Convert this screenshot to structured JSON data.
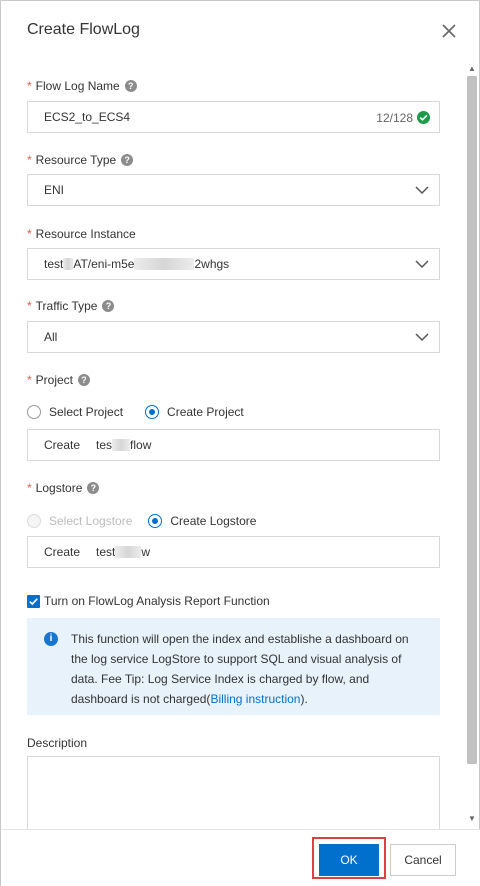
{
  "dialog": {
    "title": "Create FlowLog"
  },
  "fields": {
    "required_mark": "*",
    "help_glyph": "?",
    "flow_log_name": {
      "label": "Flow Log Name",
      "value": "ECS2_to_ECS4",
      "counter": "12/128"
    },
    "resource_type": {
      "label": "Resource Type",
      "value": "ENI"
    },
    "resource_instance": {
      "label": "Resource Instance",
      "value_start": "test",
      "value_mid1": "AT/eni-m5e",
      "value_end": "2whgs"
    },
    "traffic_type": {
      "label": "Traffic Type",
      "value": "All"
    },
    "project": {
      "label": "Project",
      "option_select": "Select Project",
      "option_create": "Create Project",
      "selected": "Create Project",
      "input_prefix": "Create",
      "value_start": "tes",
      "value_end": "flow"
    },
    "logstore": {
      "label": "Logstore",
      "option_select": "Select Logstore",
      "option_create": "Create Logstore",
      "selected": "Create Logstore",
      "input_prefix": "Create",
      "value_start": "test",
      "value_end": "w"
    },
    "analysis_report": {
      "label": "Turn on FlowLog Analysis Report Function",
      "checked": true
    },
    "info": {
      "icon": "i",
      "text": "This function will open the index and establishe a dashboard on the log service LogStore to support SQL and visual analysis of data. Fee Tip: Log Service Index is charged by flow, and dashboard is not charged(",
      "link": "Billing instruction",
      "text_end": ")."
    },
    "description": {
      "label": "Description",
      "value": ""
    }
  },
  "footer": {
    "ok_label": "OK",
    "cancel_label": "Cancel"
  },
  "colors": {
    "primary": "#0070cc",
    "required": "#e65c49",
    "success": "#1f9a4a",
    "highlight_outline": "#e0403d"
  },
  "icons": {
    "close": "close-icon",
    "help": "help-circle-icon",
    "valid": "check-circle-icon",
    "dropdown": "chevron-down-icon",
    "info": "info-circle-icon",
    "checkbox": "checkbox-checked-icon"
  }
}
